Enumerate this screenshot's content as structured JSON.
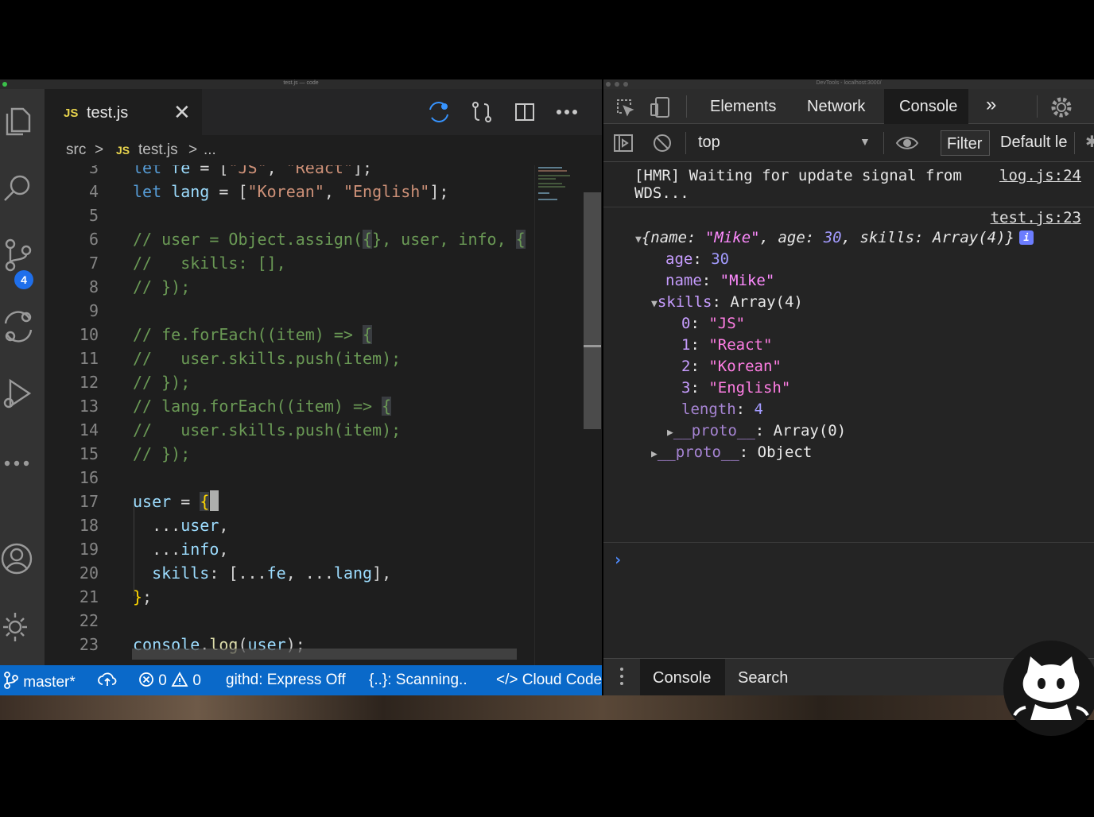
{
  "vscode": {
    "window_title": "test.js — code",
    "activity_badge": "4",
    "tab": {
      "lang_badge": "JS",
      "filename": "test.js",
      "close_glyph": "✕"
    },
    "breadcrumb": {
      "folder": "src",
      "sep1": ">",
      "lang_badge": "JS",
      "file": "test.js",
      "sep2": ">",
      "more": "..."
    },
    "lines": [
      {
        "n": "3",
        "y": -12
      },
      {
        "n": "4"
      },
      {
        "n": "5"
      },
      {
        "n": "6"
      },
      {
        "n": "7"
      },
      {
        "n": "8"
      },
      {
        "n": "9"
      },
      {
        "n": "10"
      },
      {
        "n": "11"
      },
      {
        "n": "12"
      },
      {
        "n": "13"
      },
      {
        "n": "14"
      },
      {
        "n": "15"
      },
      {
        "n": "16"
      },
      {
        "n": "17"
      },
      {
        "n": "18"
      },
      {
        "n": "19"
      },
      {
        "n": "20"
      },
      {
        "n": "21"
      },
      {
        "n": "22"
      },
      {
        "n": "23"
      }
    ],
    "status": {
      "branch": "master*",
      "errors": "0",
      "warnings": "0",
      "githd": "githd: Express Off",
      "scanning": "{..}: Scanning..",
      "cloud": "Cloud Code"
    }
  },
  "devtools": {
    "window_title": "DevTools - localhost:3000/",
    "tabs": [
      "Elements",
      "Network",
      "Console"
    ],
    "active_tab": "Console",
    "more_tabs": "»",
    "context": "top",
    "filter_label": "Filter",
    "levels_label": "Default levels",
    "console": {
      "hmr_line1": "[HMR] Waiting for update signal from",
      "hmr_line2": "WDS...",
      "hmr_src": "log.js:24",
      "obj_src": "test.js:23",
      "obj_summary": {
        "open": "{",
        "k1": "name",
        "v1": "\"Mike\"",
        "k2": "age",
        "v2": "30",
        "k3": "skills",
        "v3": "Array(4)",
        "close": "}"
      },
      "age_key": "age",
      "age_val": "30",
      "name_key": "name",
      "name_val": "\"Mike\"",
      "skills_key": "skills",
      "skills_val": "Array(4)",
      "items": [
        {
          "i": "0",
          "v": "\"JS\""
        },
        {
          "i": "1",
          "v": "\"React\""
        },
        {
          "i": "2",
          "v": "\"Korean\""
        },
        {
          "i": "3",
          "v": "\"English\""
        }
      ],
      "length_key": "length",
      "length_val": "4",
      "proto_arr_key": "__proto__",
      "proto_arr_val": "Array(0)",
      "proto_obj_key": "__proto__",
      "proto_obj_val": "Object"
    },
    "drawer_tabs": [
      "Console",
      "Search"
    ]
  },
  "colors": {
    "status_bar": "#0a69c9",
    "comment": "#6a9955",
    "keyword": "#569cd6",
    "string": "#ce9178",
    "console_prompt": "#4f8cff"
  }
}
